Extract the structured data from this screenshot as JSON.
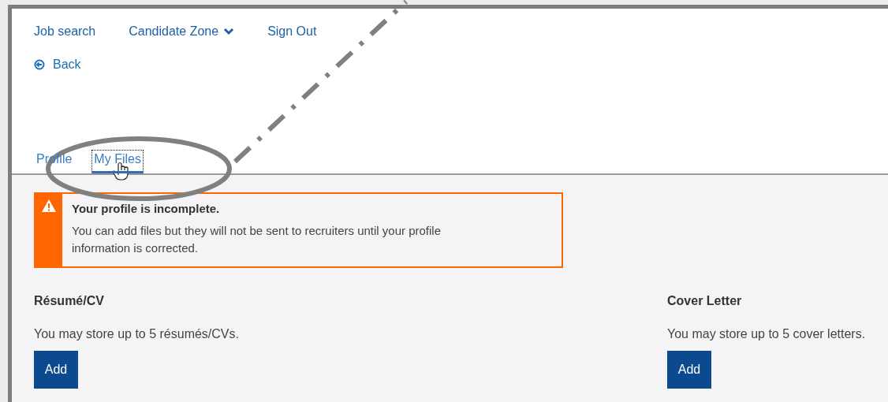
{
  "nav": [
    {
      "label": "Job search",
      "kind": "link"
    },
    {
      "label": "Candidate Zone",
      "kind": "dropdown"
    },
    {
      "label": "Sign Out",
      "kind": "link"
    }
  ],
  "back": {
    "label": "Back"
  },
  "tabs": [
    {
      "label": "Profile",
      "selected": false
    },
    {
      "label": "My Files",
      "selected": true
    }
  ],
  "alert": {
    "title": "Your profile is incomplete.",
    "message": "You can add files but they will not be sent to recruiters until your profile information is corrected."
  },
  "sections": [
    {
      "title": "Résumé/CV",
      "note": "You may store up to 5 résumés/CVs.",
      "button": "Add"
    },
    {
      "title": "Cover Letter",
      "note": "You may store up to 5 cover letters.",
      "button": "Add"
    }
  ]
}
